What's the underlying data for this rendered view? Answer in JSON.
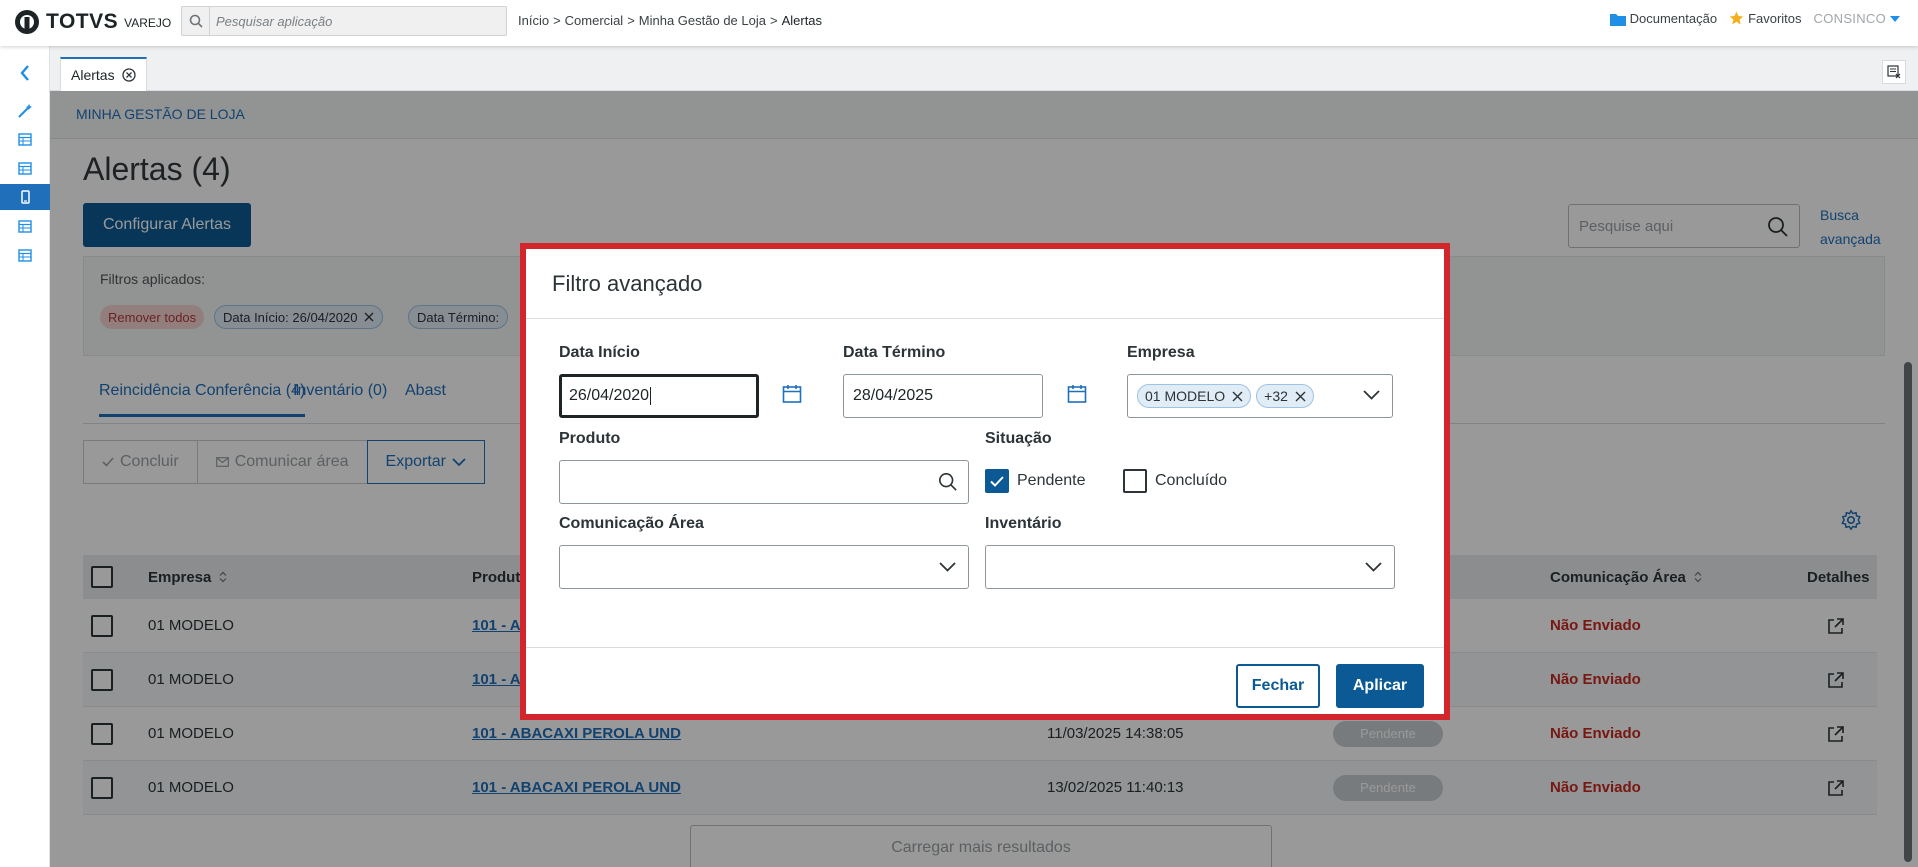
{
  "header": {
    "brand": "TOTVS",
    "brand_sub": "VAREJO",
    "search_placeholder": "Pesquisar aplicação",
    "breadcrumb": [
      "Início",
      ">",
      "Comercial",
      ">",
      "Minha Gestão de Loja",
      ">",
      "Alertas"
    ],
    "documentation": "Documentação",
    "favorites": "Favoritos",
    "user": "CONSINCO"
  },
  "colors": {
    "primary": "#0c5a95",
    "link": "#1f6fba",
    "danger": "#c8281f",
    "highlight_border": "#d2262c"
  },
  "tab": {
    "label": "Alertas"
  },
  "page": {
    "section": "MINHA GESTÃO DE LOJA",
    "title": "Alertas (4)",
    "configure_button": "Configurar Alertas",
    "search_placeholder": "Pesquise aqui",
    "advanced_search": "Busca avançada",
    "filters_label": "Filtros aplicados:",
    "remove_all": "Remover todos",
    "filter_chips": [
      "Data Início: 26/04/2020",
      "Data Término:"
    ],
    "tabs": [
      "Reincidência Conferência (4)",
      "Inventário (0)",
      "Abast"
    ],
    "actions": {
      "conclude": "Concluir",
      "communicate": "Comunicar área",
      "export": "Exportar"
    },
    "table": {
      "columns": {
        "company": "Empresa",
        "product": "Produt",
        "communication": "Comunicação Área",
        "details": "Detalhes"
      },
      "rows": [
        {
          "company": "01 MODELO",
          "product": "101 - A",
          "date": "",
          "status": "",
          "communication": "Não Enviado"
        },
        {
          "company": "01 MODELO",
          "product": "101 - A",
          "date": "",
          "status": "",
          "communication": "Não Enviado"
        },
        {
          "company": "01 MODELO",
          "product": "101 - ABACAXI PEROLA UND",
          "date": "11/03/2025 14:38:05",
          "status": "Pendente",
          "communication": "Não Enviado"
        },
        {
          "company": "01 MODELO",
          "product": "101 - ABACAXI PEROLA UND",
          "date": "13/02/2025 11:40:13",
          "status": "Pendente",
          "communication": "Não Enviado"
        }
      ]
    },
    "load_more": "Carregar mais resultados"
  },
  "modal": {
    "title": "Filtro avançado",
    "start_date_label": "Data Início",
    "start_date_value": "26/04/2020",
    "end_date_label": "Data Término",
    "end_date_value": "28/04/2025",
    "company_label": "Empresa",
    "company_tags": [
      "01 MODELO",
      "+32"
    ],
    "product_label": "Produto",
    "product_value": "",
    "status_label": "Situação",
    "status_pending": "Pendente",
    "status_pending_checked": true,
    "status_done": "Concluído",
    "status_done_checked": false,
    "communication_label": "Comunicação Área",
    "communication_value": "",
    "inventory_label": "Inventário",
    "inventory_value": "",
    "close_button": "Fechar",
    "apply_button": "Aplicar"
  }
}
